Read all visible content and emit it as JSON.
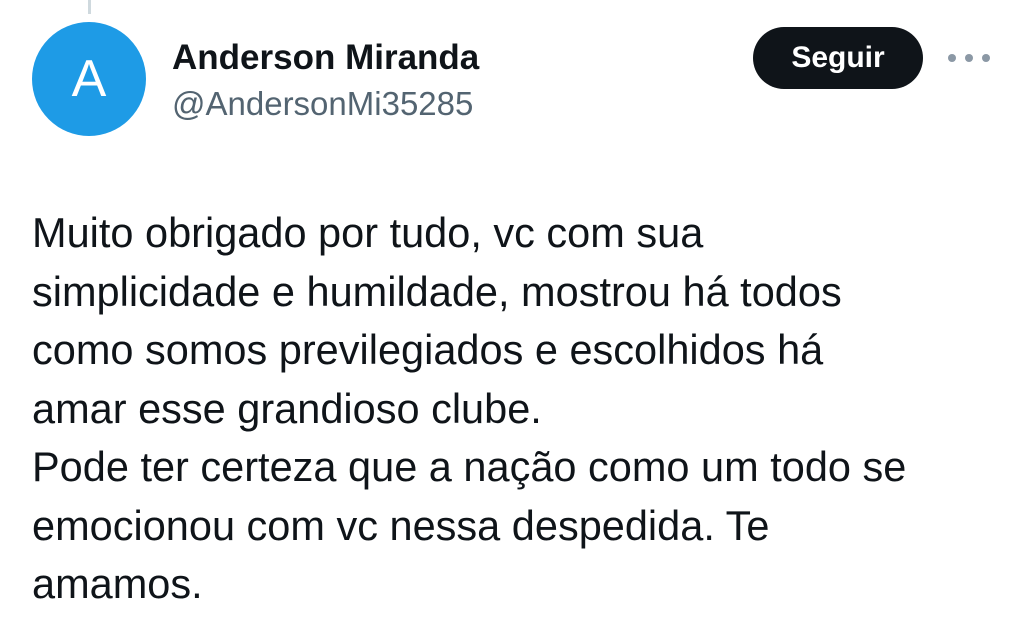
{
  "author": {
    "avatar_letter": "A",
    "display_name": "Anderson Miranda",
    "handle": "@AndersonMi35285",
    "avatar_color": "#1e9be6"
  },
  "actions": {
    "follow_label": "Seguir",
    "more_icon": "more-horizontal-icon"
  },
  "tweet": {
    "text": "Muito obrigado por tudo, vc com sua\nsimplicidade e humildade, mostrou há todos\ncomo somos previlegiados e escolhidos há\namar esse grandioso clube.\nPode ter certeza que a nação como um todo se\nemocionou com vc nessa despedida. Te\namamos."
  },
  "colors": {
    "text_primary": "#0f1419",
    "text_secondary": "#536471",
    "button_bg": "#0f1419"
  }
}
